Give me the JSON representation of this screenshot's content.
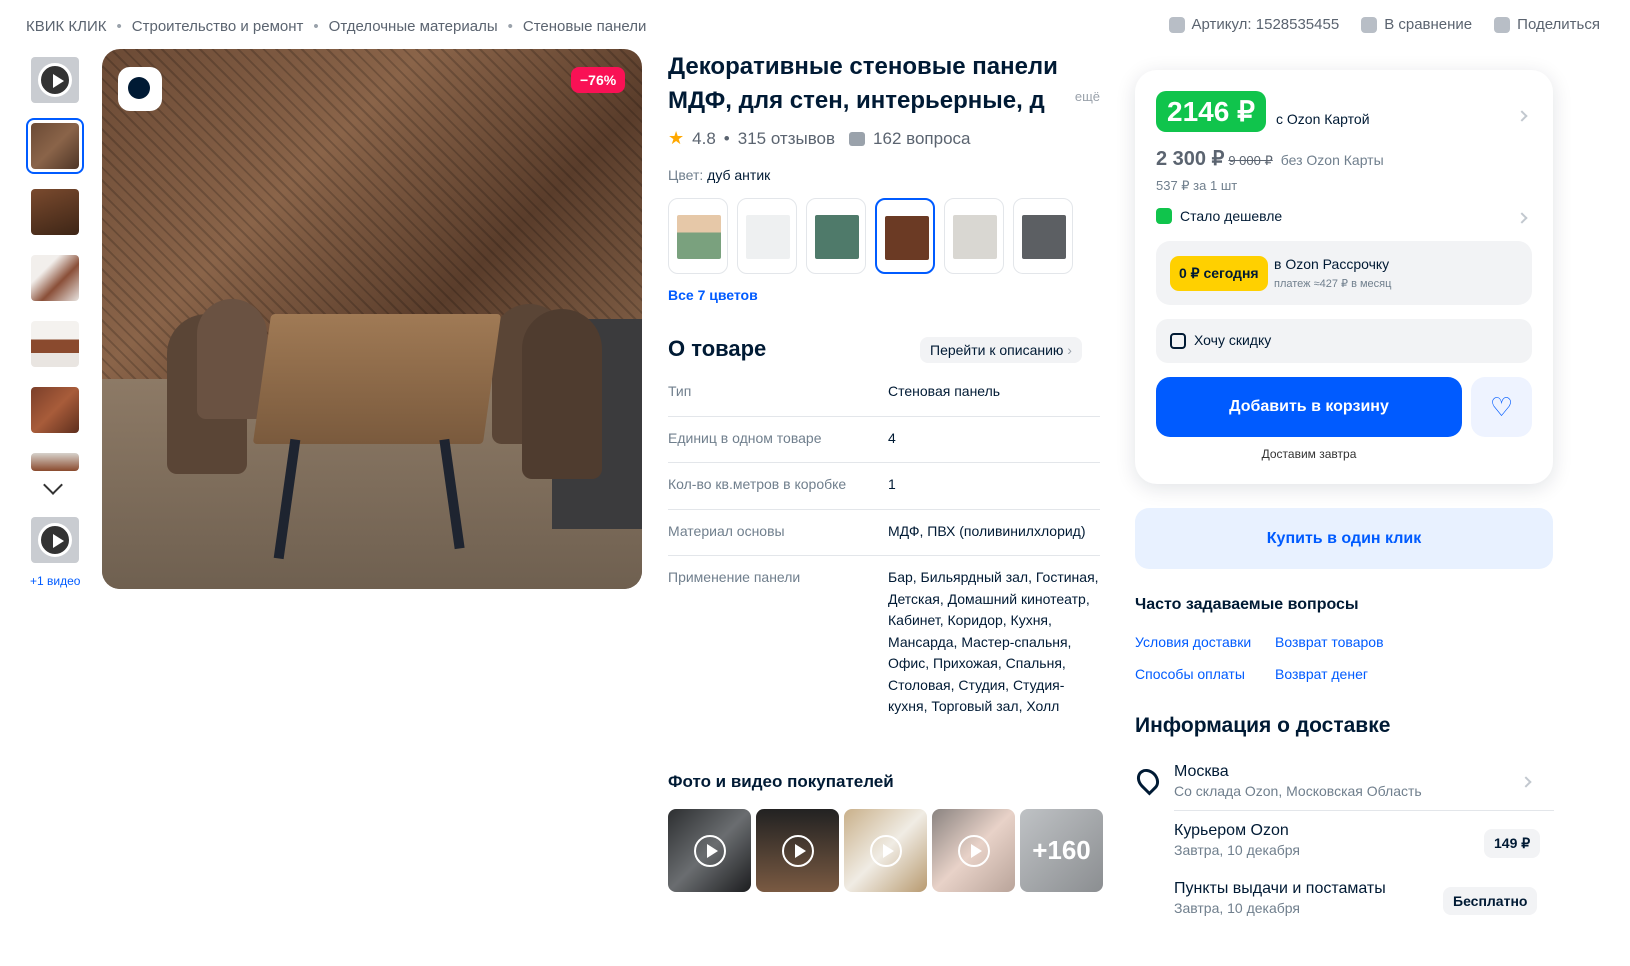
{
  "breadcrumbs": [
    "КВИК КЛИК",
    "Строительство и ремонт",
    "Отделочные материалы",
    "Стеновые панели"
  ],
  "breadcrumb_sep": "•",
  "top_actions": {
    "article": "Артикул: 1528535455",
    "compare": "В сравнение",
    "share": "Поделиться"
  },
  "gallery": {
    "more_video": "+1 видео",
    "discount": "−76%"
  },
  "product": {
    "title_line1": "Декоративные стеновые панели",
    "title_line2": "МДФ, для стен, интерьерные, д",
    "title_more": "ещё",
    "rating": "4.8",
    "reviews": "315 отзывов",
    "questions": "162 вопроса",
    "color_label": "Цвет:",
    "color_value": "дуб антик",
    "all_colors": "Все 7 цветов",
    "swatch_colors": [
      "#8aa785",
      "#eef0f1",
      "#4f7a6a",
      "#6b3a24",
      "#d9d7d2",
      "#5c5f63"
    ]
  },
  "about": {
    "title": "О товаре",
    "goto": "Перейти к описанию",
    "props": [
      {
        "k": "Тип",
        "v": "Стеновая панель"
      },
      {
        "k": "Единиц в одном товаре",
        "v": "4"
      },
      {
        "k": "Кол-во кв.метров в коробке",
        "v": "1"
      },
      {
        "k": "Материал основы",
        "v": "МДФ, ПВХ (поливинилхлорид)"
      },
      {
        "k": "Применение панели",
        "v": "Бар, Бильярдный зал, Гостиная, Детская, Домашний кинотеатр, Кабинет, Коридор, Кухня, Мансарда, Мастер-спальня, Офис, Прихожая, Спальня, Столовая, Студия, Студия-кухня, Торговый зал, Холл"
      }
    ]
  },
  "buyers": {
    "title": "Фото и видео покупателей",
    "more": "+160"
  },
  "price": {
    "card_price": "2146 ₽",
    "with_card": "с Ozon Картой",
    "regular": "2 300 ₽",
    "old": "9 000 ₽",
    "without_card": "без Ozon Карты",
    "per_unit": "537 ₽ за 1 шт",
    "cheaper": "Стало дешевле",
    "installment_badge": "0 ₽ сегодня",
    "installment_title": "в Ozon Рассрочку",
    "installment_sub": "платеж ≈427 ₽ в месяц",
    "want_discount": "Хочу скидку",
    "add_to_cart": "Добавить в корзину",
    "delivery_note": "Доставим завтра",
    "one_click": "Купить в один клик"
  },
  "faq": {
    "title": "Часто задаваемые вопросы",
    "links": [
      "Условия доставки",
      "Возврат товаров",
      "Способы оплаты",
      "Возврат денег"
    ]
  },
  "delivery": {
    "title": "Информация о доставке",
    "city": "Москва",
    "city_sub": "Со склада Ozon, Московская Область",
    "courier": "Курьером Ozon",
    "courier_date": "Завтра, 10 декабря",
    "courier_price": "149 ₽",
    "pickup": "Пункты выдачи и постаматы",
    "pickup_date": "Завтра, 10 декабря",
    "pickup_price": "Бесплатно"
  }
}
